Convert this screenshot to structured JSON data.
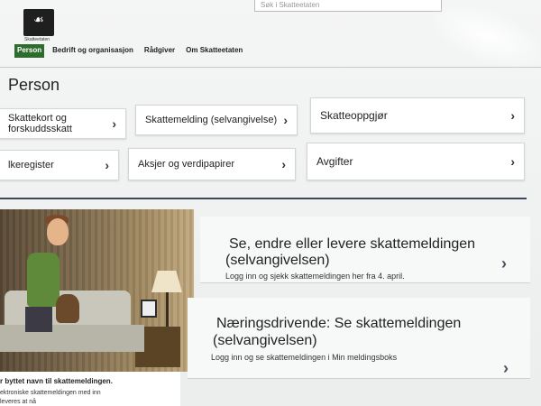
{
  "header": {
    "search_placeholder": "Søk i Skatteetaten",
    "logo_text": "Skatteetaten",
    "nav": [
      {
        "label": "Person",
        "active": true
      },
      {
        "label": "Bedrift og organisasjon",
        "active": false
      },
      {
        "label": "Rådgiver",
        "active": false
      },
      {
        "label": "Om Skatteetaten",
        "active": false
      }
    ]
  },
  "page_title": "Person",
  "tiles": [
    {
      "label": "Skattekort og forskuddsskatt"
    },
    {
      "label": "Skattemelding (selvangivelse)"
    },
    {
      "label": "Skatteoppgjør"
    },
    {
      "label": "lkeregister"
    },
    {
      "label": "Aksjer og verdipapirer"
    },
    {
      "label": "Avgifter"
    }
  ],
  "hero": {
    "caption": "r byttet navn til skattemeldingen.",
    "text_line1": "ektroniske skattemeldingen med inn",
    "text_line2": "leveres at nå"
  },
  "cards": [
    {
      "title_line1": "Se, endre eller levere skattemeldingen",
      "title_line2": "(selvangivelsen)",
      "subtitle": "Logg inn og sjekk skattemeldingen her fra 4. april."
    },
    {
      "title_line1": "Næringsdrivende: Se skattemeldingen",
      "title_line2": "(selvangivelsen)",
      "subtitle": "Logg inn og se skattemeldingen i Min meldingsboks"
    }
  ],
  "colors": {
    "nav_active": "#2e6b2e",
    "divider": "#3b4a5a"
  },
  "icons": {
    "chevron": "chevron-right-icon",
    "logo": "skatteetaten-logo"
  }
}
